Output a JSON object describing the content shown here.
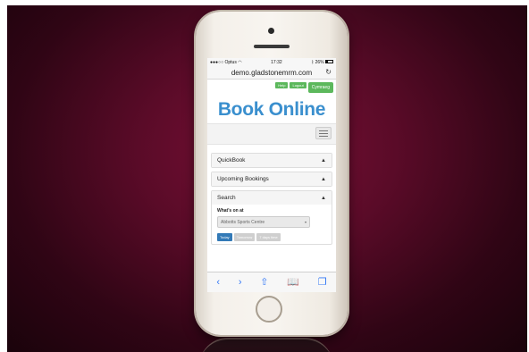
{
  "status_bar": {
    "carrier": "Optus",
    "time": "17:32",
    "battery": "26%"
  },
  "browser": {
    "url": "demo.gladstonemrm.com"
  },
  "header": {
    "help_label": "Help",
    "logout_label": "Logout",
    "language_label": "Cymraeg"
  },
  "page": {
    "title": "Book Online"
  },
  "panels": {
    "quickbook": "QuickBook",
    "upcoming": "Upcoming Bookings",
    "search": "Search"
  },
  "search": {
    "whats_on_label": "What's on at",
    "venue_selected": "Abbotts Sports Centre",
    "date_buttons": [
      "Today",
      "Tomorrow",
      "7 days time"
    ]
  },
  "colors": {
    "accent": "#3a8fce",
    "button_green": "#5cb85c",
    "button_blue": "#337ab7",
    "background": "#5a0b28"
  },
  "icons": {
    "back": "chevron-left-icon",
    "forward": "chevron-right-icon",
    "share": "share-icon",
    "bookmarks": "book-icon",
    "tabs": "tabs-icon"
  }
}
